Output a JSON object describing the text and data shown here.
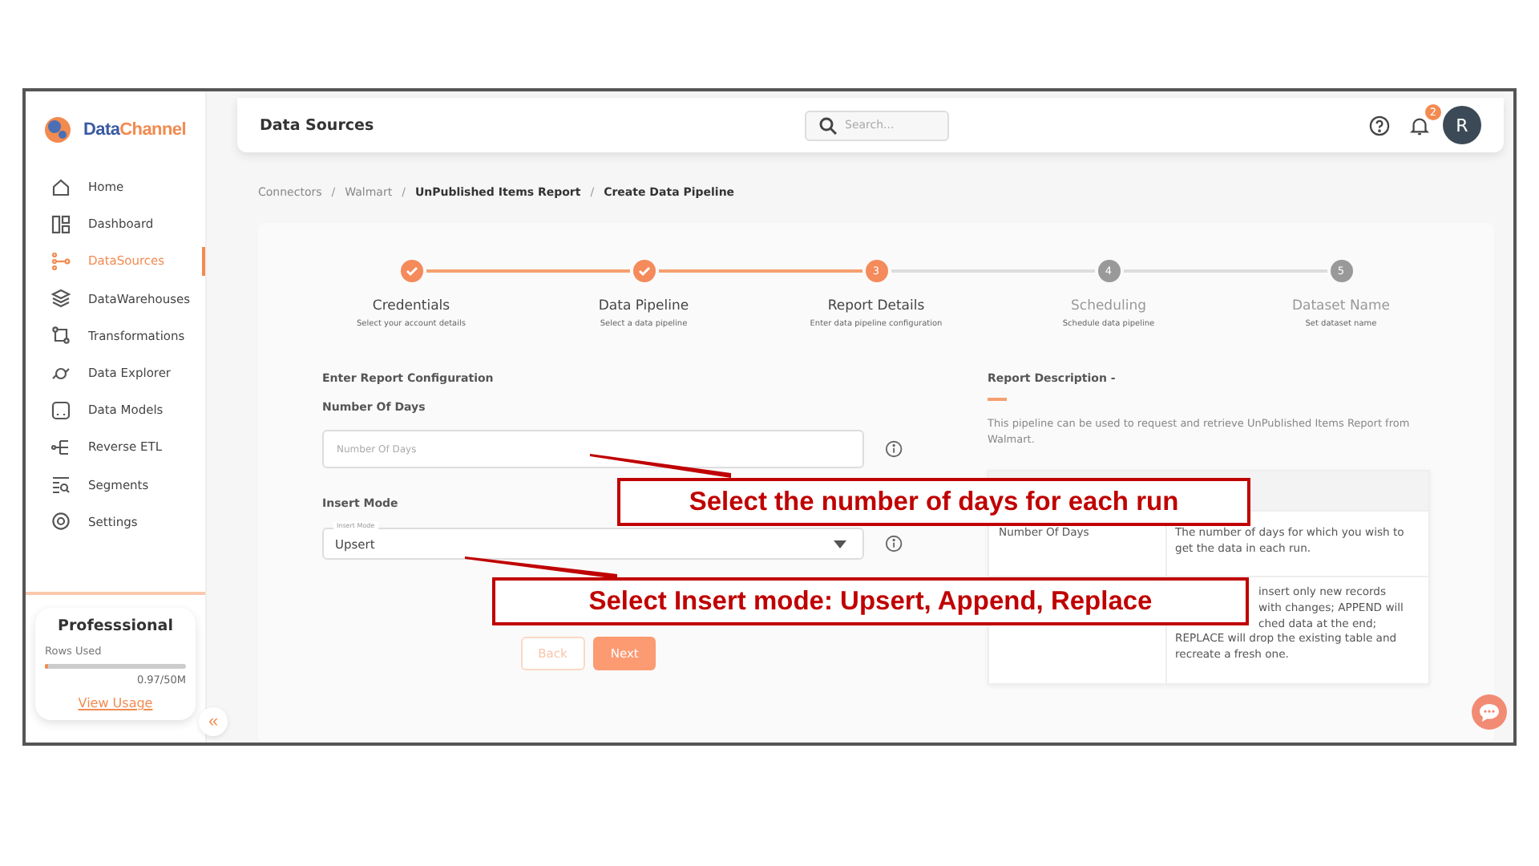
{
  "brand": {
    "part1": "Data",
    "part2": "Channel"
  },
  "sidebar": {
    "items": [
      {
        "label": "Home",
        "selected": false
      },
      {
        "label": "Dashboard",
        "selected": false
      },
      {
        "label": "DataSources",
        "selected": true
      },
      {
        "label": "DataWarehouses",
        "selected": false
      },
      {
        "label": "Transformations",
        "selected": false
      },
      {
        "label": "Data Explorer",
        "selected": false
      },
      {
        "label": "Data Models",
        "selected": false
      },
      {
        "label": "Reverse ETL",
        "selected": false
      },
      {
        "label": "Segments",
        "selected": false
      },
      {
        "label": "Settings",
        "selected": false
      }
    ],
    "plan": {
      "name": "Professsional",
      "rows_label": "Rows Used",
      "level": 0.02,
      "reading": "0.97/50M",
      "link": "View Usage"
    },
    "collapse": "«"
  },
  "header": {
    "title": "Data Sources",
    "search": {
      "placeholder": "Search..."
    },
    "notifications": "2",
    "avatar": "R"
  },
  "breadcrumb": [
    {
      "label": "Connectors",
      "current": false
    },
    {
      "separator": "/",
      "label": "Walmart",
      "current": false
    },
    {
      "separator": "/",
      "label": "UnPublished Items Report",
      "current": true
    },
    {
      "separator": "/",
      "label": "Create Data Pipeline",
      "current": true
    }
  ],
  "steps": [
    {
      "title": "Credentials",
      "subtitle": "Select your account details",
      "kind": "done"
    },
    {
      "title": "Data Pipeline",
      "subtitle": "Select a data pipeline",
      "kind": "done"
    },
    {
      "number": "3",
      "title": "Report Details",
      "subtitle": "Enter data pipeline configuration",
      "kind": "current"
    },
    {
      "number": "4",
      "title": "Scheduling",
      "subtitle": "Schedule data pipeline",
      "kind": "pending"
    },
    {
      "number": "5",
      "title": "Dataset Name",
      "subtitle": "Set dataset name",
      "kind": "pending"
    }
  ],
  "form": {
    "heading": "Enter Report Configuration",
    "days": {
      "label": "Number Of Days",
      "placeholder": "Number Of Days"
    },
    "mode": {
      "label": "Insert Mode",
      "floating_label": "Insert Mode",
      "value": "Upsert"
    },
    "buttons": [
      {
        "label": "Back",
        "kind": "secondary"
      },
      {
        "label": "Next",
        "kind": "primary"
      }
    ]
  },
  "description": {
    "title": "Report Description -",
    "text": "This pipeline can be used to request and retrieve UnPublished Items Report from Walmart.",
    "rows": [
      {
        "name": "Number Of Days",
        "lines": [
          "The number of days for which you wish to get the data in each run."
        ]
      },
      {
        "lines": [
          "insert only new records",
          "with changes; APPEND will",
          "ched data at the end;",
          "REPLACE will drop the existing table and recreate a fresh one."
        ]
      }
    ]
  },
  "callouts": [
    "Select the number of days for each run",
    "Select Insert mode: Upsert, Append, Replace"
  ]
}
